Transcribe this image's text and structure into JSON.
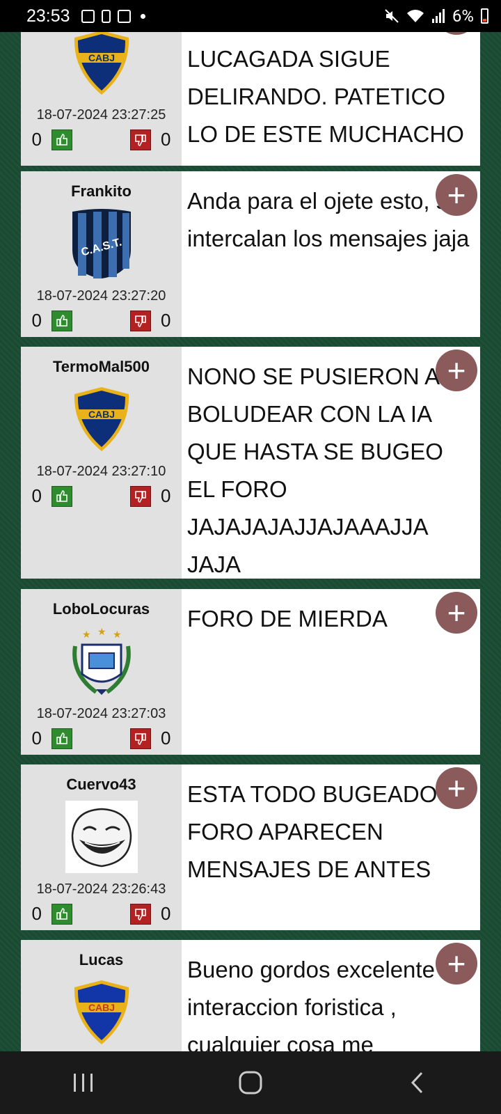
{
  "status_bar": {
    "time": "23:53",
    "battery": "6%"
  },
  "posts": [
    {
      "username": "",
      "team": "CABJ",
      "date": "18-07-2024 23:27:25",
      "likes": "0",
      "dislikes": "0",
      "message": "LUCAGADA SIGUE DELIRANDO. PATETICO LO DE ESTE MUCHACHO"
    },
    {
      "username": "Frankito",
      "team": "C.A.S.T.",
      "date": "18-07-2024 23:27:20",
      "likes": "0",
      "dislikes": "0",
      "message": "Anda para el ojete esto, se intercalan los mensajes jaja"
    },
    {
      "username": "TermoMal500",
      "team": "CABJ",
      "date": "18-07-2024 23:27:10",
      "likes": "0",
      "dislikes": "0",
      "message": "NONO SE PUSIERON A BOLUDEAR CON LA IA QUE HASTA SE BUGEO EL FORO JAJAJAJAJJAJAAAJJA JAJA"
    },
    {
      "username": "LoboLocuras",
      "team": "GELP",
      "date": "18-07-2024 23:27:03",
      "likes": "0",
      "dislikes": "0",
      "message": "FORO DE MIERDA"
    },
    {
      "username": "Cuervo43",
      "team": "trollface",
      "date": "18-07-2024 23:26:43",
      "likes": "0",
      "dislikes": "0",
      "message": "ESTA TODO BUGEADO EL FORO APARECEN MENSAJES DE ANTES"
    },
    {
      "username": "Lucas",
      "team": "CABJ",
      "date": "",
      "likes": "",
      "dislikes": "",
      "message": "Bueno gordos excelente interaccion foristica , cualquier cosa me"
    }
  ],
  "plus_label": "+",
  "colors": {
    "background": "#1b4a33",
    "plus_button": "#8b5a5a",
    "vote_up": "#2e8b2e",
    "vote_down": "#b22222"
  }
}
